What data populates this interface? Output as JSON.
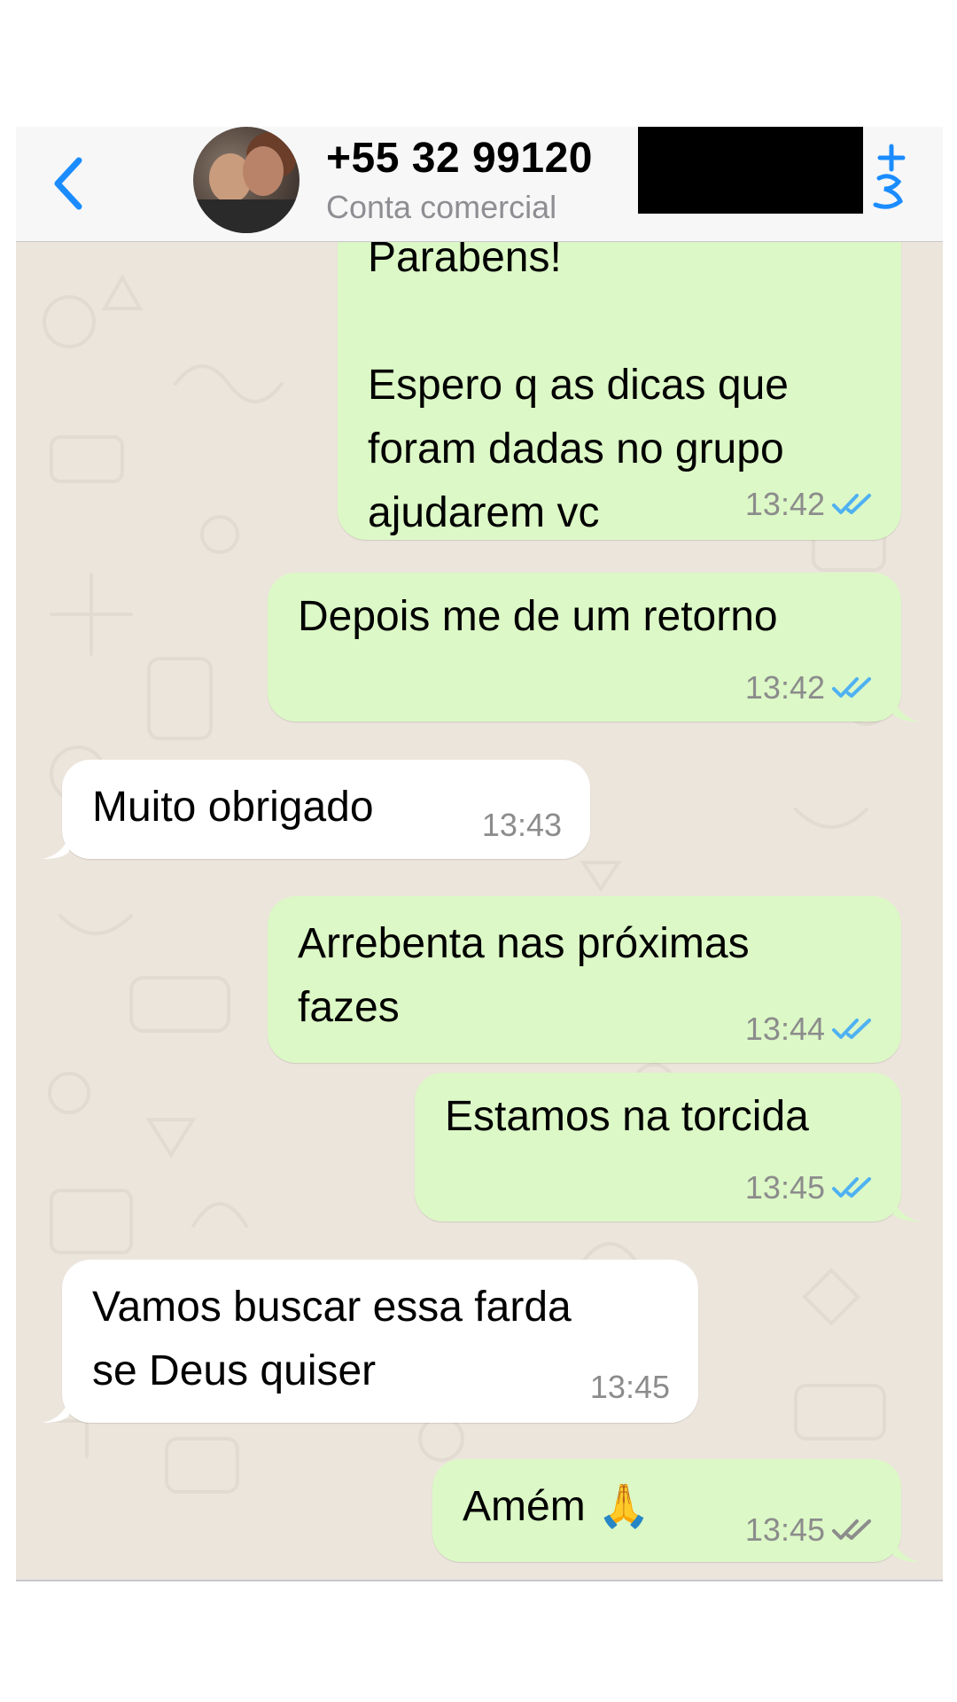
{
  "header": {
    "contact_name": "+55 32 99120",
    "subtitle": "Conta comercial"
  },
  "messages": [
    {
      "direction": "outgoing",
      "text": "Parabens!\n\nEspero q as dicas que\nforam dadas no grupo\najudarem vc",
      "time": "13:42",
      "status": "read"
    },
    {
      "direction": "outgoing",
      "text": "Depois me de um retorno",
      "time": "13:42",
      "status": "read"
    },
    {
      "direction": "incoming",
      "text": "Muito obrigado",
      "time": "13:43"
    },
    {
      "direction": "outgoing",
      "text": "Arrebenta nas próximas\nfazes",
      "time": "13:44",
      "status": "read"
    },
    {
      "direction": "outgoing",
      "text": "Estamos na torcida",
      "time": "13:45",
      "status": "read"
    },
    {
      "direction": "incoming",
      "text": "Vamos buscar essa farda\nse Deus quiser",
      "time": "13:45"
    },
    {
      "direction": "outgoing",
      "text": "Amém 🙏",
      "time": "13:45",
      "status": "delivered"
    }
  ],
  "colors": {
    "accent": "#1a8cff",
    "outgoing_bubble": "#dcf8c6",
    "incoming_bubble": "#ffffff",
    "chat_background": "#ece5dc",
    "read_tick": "#4fb1f2",
    "delivered_tick": "#8c8c8c"
  },
  "icons": {
    "back": "chevron-left-icon",
    "add_contact": "plus-person-icon",
    "read": "double-check-icon"
  }
}
